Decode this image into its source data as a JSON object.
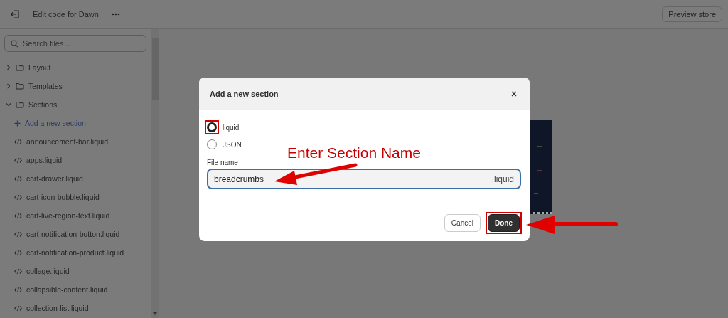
{
  "topbar": {
    "title": "Edit code for Dawn",
    "preview_button": "Preview store"
  },
  "sidebar": {
    "search": {
      "placeholder": "Search files..."
    },
    "tree": [
      {
        "kind": "folder",
        "label": "Layout",
        "expanded": false
      },
      {
        "kind": "folder",
        "label": "Templates",
        "expanded": false
      },
      {
        "kind": "folder",
        "label": "Sections",
        "expanded": true,
        "children": [
          {
            "kind": "add",
            "label": "Add a new section"
          },
          {
            "kind": "file",
            "label": "announcement-bar.liquid"
          },
          {
            "kind": "file",
            "label": "apps.liquid"
          },
          {
            "kind": "file",
            "label": "cart-drawer.liquid"
          },
          {
            "kind": "file",
            "label": "cart-icon-bubble.liquid"
          },
          {
            "kind": "file",
            "label": "cart-live-region-text.liquid"
          },
          {
            "kind": "file",
            "label": "cart-notification-button.liquid"
          },
          {
            "kind": "file",
            "label": "cart-notification-product.liquid"
          },
          {
            "kind": "file",
            "label": "collage.liquid"
          },
          {
            "kind": "file",
            "label": "collapsible-content.liquid"
          },
          {
            "kind": "file",
            "label": "collection-list.liquid"
          }
        ]
      }
    ]
  },
  "dialog": {
    "title": "Add a new section",
    "options": [
      {
        "label": "liquid",
        "selected": true,
        "highlighted": true
      },
      {
        "label": "JSON",
        "selected": false,
        "highlighted": false
      }
    ],
    "field": {
      "label": "File name",
      "value": "breadcrumbs",
      "suffix": ".liquid"
    },
    "buttons": [
      {
        "label": "Cancel",
        "kind": "secondary",
        "highlighted": false
      },
      {
        "label": "Done",
        "kind": "primary",
        "highlighted": true
      }
    ]
  },
  "annotation": {
    "text": "Enter Section Name"
  }
}
